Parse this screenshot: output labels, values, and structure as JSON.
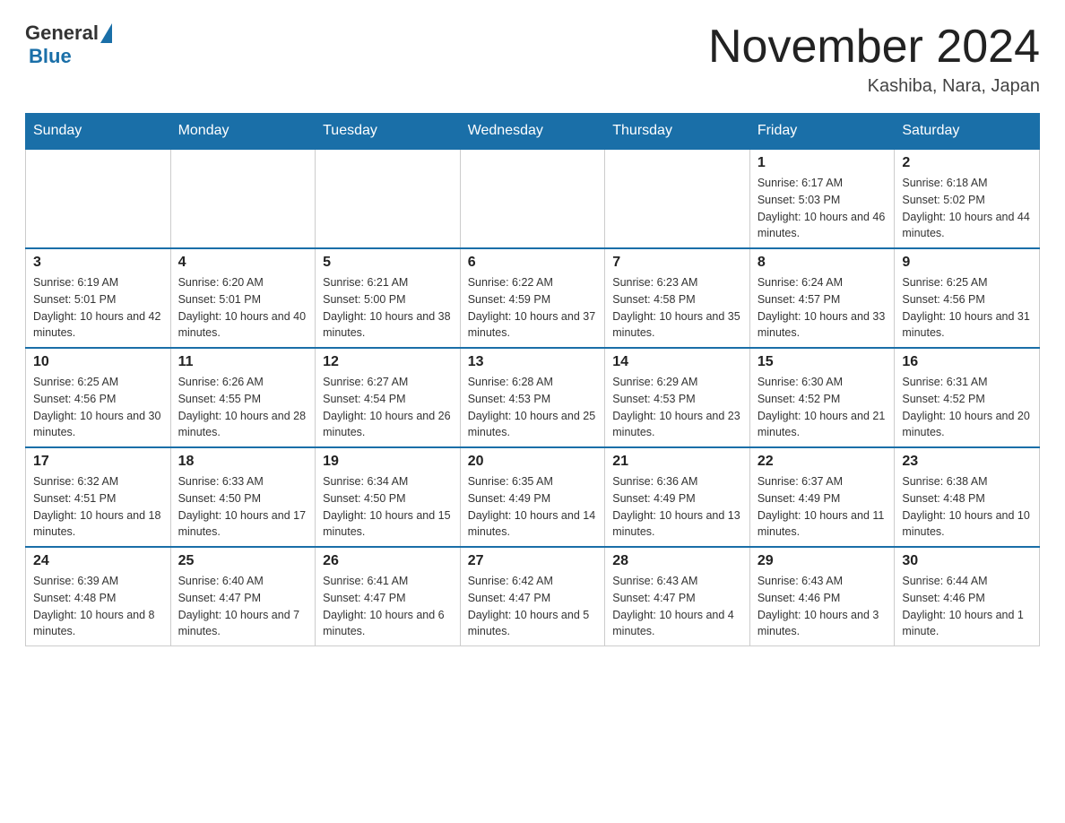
{
  "header": {
    "logo_general": "General",
    "logo_blue": "Blue",
    "month_title": "November 2024",
    "location": "Kashiba, Nara, Japan"
  },
  "days_of_week": [
    "Sunday",
    "Monday",
    "Tuesday",
    "Wednesday",
    "Thursday",
    "Friday",
    "Saturday"
  ],
  "weeks": [
    [
      {
        "day": "",
        "info": ""
      },
      {
        "day": "",
        "info": ""
      },
      {
        "day": "",
        "info": ""
      },
      {
        "day": "",
        "info": ""
      },
      {
        "day": "",
        "info": ""
      },
      {
        "day": "1",
        "info": "Sunrise: 6:17 AM\nSunset: 5:03 PM\nDaylight: 10 hours and 46 minutes."
      },
      {
        "day": "2",
        "info": "Sunrise: 6:18 AM\nSunset: 5:02 PM\nDaylight: 10 hours and 44 minutes."
      }
    ],
    [
      {
        "day": "3",
        "info": "Sunrise: 6:19 AM\nSunset: 5:01 PM\nDaylight: 10 hours and 42 minutes."
      },
      {
        "day": "4",
        "info": "Sunrise: 6:20 AM\nSunset: 5:01 PM\nDaylight: 10 hours and 40 minutes."
      },
      {
        "day": "5",
        "info": "Sunrise: 6:21 AM\nSunset: 5:00 PM\nDaylight: 10 hours and 38 minutes."
      },
      {
        "day": "6",
        "info": "Sunrise: 6:22 AM\nSunset: 4:59 PM\nDaylight: 10 hours and 37 minutes."
      },
      {
        "day": "7",
        "info": "Sunrise: 6:23 AM\nSunset: 4:58 PM\nDaylight: 10 hours and 35 minutes."
      },
      {
        "day": "8",
        "info": "Sunrise: 6:24 AM\nSunset: 4:57 PM\nDaylight: 10 hours and 33 minutes."
      },
      {
        "day": "9",
        "info": "Sunrise: 6:25 AM\nSunset: 4:56 PM\nDaylight: 10 hours and 31 minutes."
      }
    ],
    [
      {
        "day": "10",
        "info": "Sunrise: 6:25 AM\nSunset: 4:56 PM\nDaylight: 10 hours and 30 minutes."
      },
      {
        "day": "11",
        "info": "Sunrise: 6:26 AM\nSunset: 4:55 PM\nDaylight: 10 hours and 28 minutes."
      },
      {
        "day": "12",
        "info": "Sunrise: 6:27 AM\nSunset: 4:54 PM\nDaylight: 10 hours and 26 minutes."
      },
      {
        "day": "13",
        "info": "Sunrise: 6:28 AM\nSunset: 4:53 PM\nDaylight: 10 hours and 25 minutes."
      },
      {
        "day": "14",
        "info": "Sunrise: 6:29 AM\nSunset: 4:53 PM\nDaylight: 10 hours and 23 minutes."
      },
      {
        "day": "15",
        "info": "Sunrise: 6:30 AM\nSunset: 4:52 PM\nDaylight: 10 hours and 21 minutes."
      },
      {
        "day": "16",
        "info": "Sunrise: 6:31 AM\nSunset: 4:52 PM\nDaylight: 10 hours and 20 minutes."
      }
    ],
    [
      {
        "day": "17",
        "info": "Sunrise: 6:32 AM\nSunset: 4:51 PM\nDaylight: 10 hours and 18 minutes."
      },
      {
        "day": "18",
        "info": "Sunrise: 6:33 AM\nSunset: 4:50 PM\nDaylight: 10 hours and 17 minutes."
      },
      {
        "day": "19",
        "info": "Sunrise: 6:34 AM\nSunset: 4:50 PM\nDaylight: 10 hours and 15 minutes."
      },
      {
        "day": "20",
        "info": "Sunrise: 6:35 AM\nSunset: 4:49 PM\nDaylight: 10 hours and 14 minutes."
      },
      {
        "day": "21",
        "info": "Sunrise: 6:36 AM\nSunset: 4:49 PM\nDaylight: 10 hours and 13 minutes."
      },
      {
        "day": "22",
        "info": "Sunrise: 6:37 AM\nSunset: 4:49 PM\nDaylight: 10 hours and 11 minutes."
      },
      {
        "day": "23",
        "info": "Sunrise: 6:38 AM\nSunset: 4:48 PM\nDaylight: 10 hours and 10 minutes."
      }
    ],
    [
      {
        "day": "24",
        "info": "Sunrise: 6:39 AM\nSunset: 4:48 PM\nDaylight: 10 hours and 8 minutes."
      },
      {
        "day": "25",
        "info": "Sunrise: 6:40 AM\nSunset: 4:47 PM\nDaylight: 10 hours and 7 minutes."
      },
      {
        "day": "26",
        "info": "Sunrise: 6:41 AM\nSunset: 4:47 PM\nDaylight: 10 hours and 6 minutes."
      },
      {
        "day": "27",
        "info": "Sunrise: 6:42 AM\nSunset: 4:47 PM\nDaylight: 10 hours and 5 minutes."
      },
      {
        "day": "28",
        "info": "Sunrise: 6:43 AM\nSunset: 4:47 PM\nDaylight: 10 hours and 4 minutes."
      },
      {
        "day": "29",
        "info": "Sunrise: 6:43 AM\nSunset: 4:46 PM\nDaylight: 10 hours and 3 minutes."
      },
      {
        "day": "30",
        "info": "Sunrise: 6:44 AM\nSunset: 4:46 PM\nDaylight: 10 hours and 1 minute."
      }
    ]
  ]
}
